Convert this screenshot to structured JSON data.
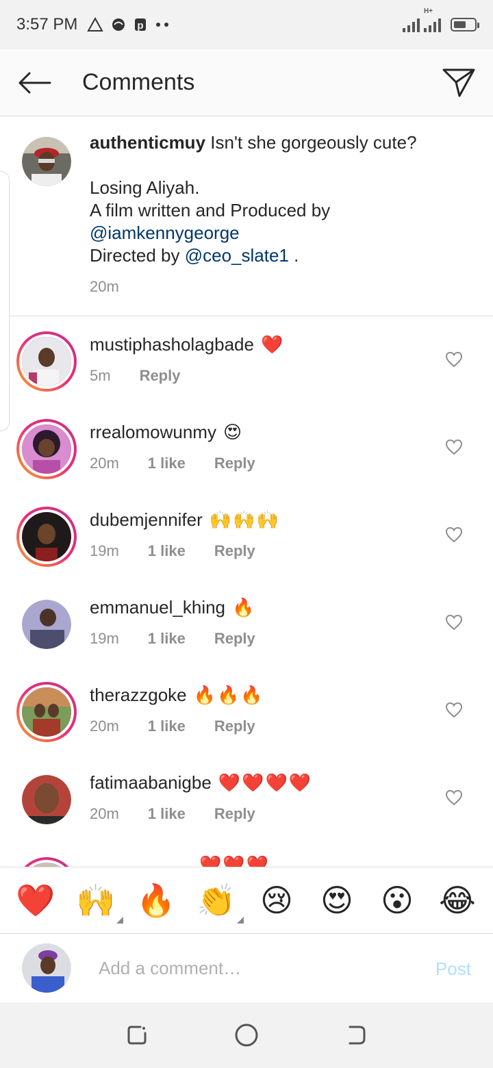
{
  "status_bar": {
    "time": "3:57 PM",
    "left_icons": [
      "warning-icon",
      "vpn-icon",
      "p-icon",
      "more-dots-icon"
    ],
    "right_icons": [
      "signal-icon",
      "signal-hplus-icon",
      "battery-icon"
    ],
    "signal_type": "H+"
  },
  "header": {
    "title": "Comments",
    "back_icon": "arrow-left-icon",
    "share_icon": "send-icon"
  },
  "caption": {
    "username": "authenticmuy",
    "text_1": "Isn't she gorgeously cute?",
    "text_2": "Losing Aliyah.",
    "text_3": "A film written and Produced by",
    "mention_1": "@iamkennygeorge",
    "text_4": "Directed by",
    "mention_2": "@ceo_slate1",
    "text_5": ".",
    "time": "20m"
  },
  "comments": [
    {
      "username": "mustiphasholagbade",
      "emoji": "❤️",
      "time": "5m",
      "likes": "",
      "reply": "Reply",
      "ring": true
    },
    {
      "username": "rrealomowunmy",
      "emoji": "😍",
      "time": "20m",
      "likes": "1 like",
      "reply": "Reply",
      "ring": true
    },
    {
      "username": "dubemjennifer",
      "emoji": "🙌🙌🙌",
      "time": "19m",
      "likes": "1 like",
      "reply": "Reply",
      "ring": true
    },
    {
      "username": "emmanuel_khing",
      "emoji": "🔥",
      "time": "19m",
      "likes": "1 like",
      "reply": "Reply",
      "ring": false
    },
    {
      "username": "therazzgoke",
      "emoji": "🔥🔥🔥",
      "time": "20m",
      "likes": "1 like",
      "reply": "Reply",
      "ring": true
    },
    {
      "username": "fatimaabanigbe",
      "emoji": "❤️❤️❤️❤️",
      "time": "20m",
      "likes": "1 like",
      "reply": "Reply",
      "ring": false
    }
  ],
  "partial_comment": {
    "emoji": "❤️❤️❤️"
  },
  "emoji_bar": [
    {
      "emoji": "❤️",
      "name": "red-heart"
    },
    {
      "emoji": "🙌",
      "name": "raising-hands",
      "has_variants": true
    },
    {
      "emoji": "🔥",
      "name": "fire"
    },
    {
      "emoji": "👏",
      "name": "clapping-hands",
      "has_variants": true
    },
    {
      "emoji": "😢",
      "name": "crying-face"
    },
    {
      "emoji": "😍",
      "name": "heart-eyes"
    },
    {
      "emoji": "😮",
      "name": "open-mouth"
    },
    {
      "emoji": "😂",
      "name": "tears-of-joy"
    }
  ],
  "input": {
    "placeholder": "Add a comment…",
    "post_label": "Post"
  },
  "colors": {
    "mention": "#00376b",
    "meta": "#8e8e8e",
    "post_disabled": "#b2dffc"
  },
  "nav_bar": {
    "icons": [
      "recents-icon",
      "home-icon",
      "back-nav-icon"
    ]
  }
}
